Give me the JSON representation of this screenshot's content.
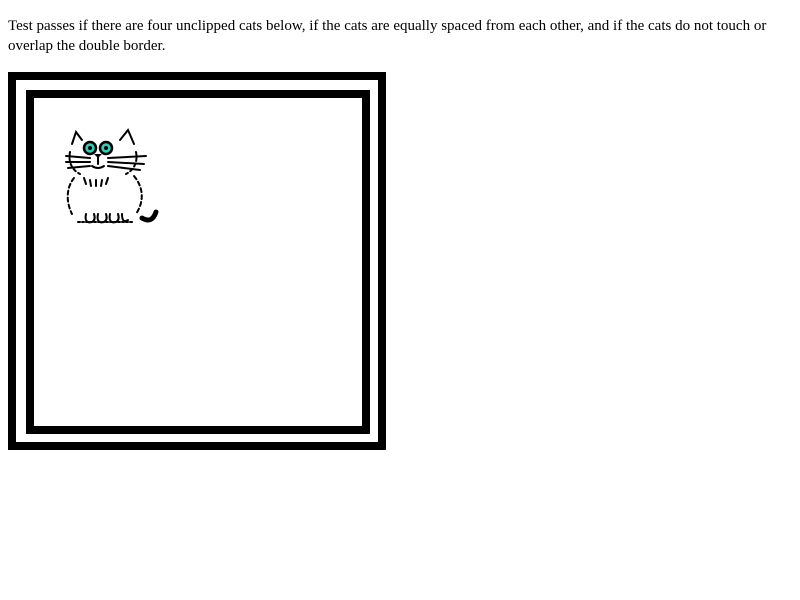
{
  "test": {
    "instructions": "Test passes if there are four unclipped cats below, if the cats are equally spaced from each other, and if the cats do not touch or overlap the double border."
  },
  "figure": {
    "icon": "cat-icon",
    "border_style": "double",
    "border_color": "#000000",
    "eye_color": "#33ccbb"
  }
}
